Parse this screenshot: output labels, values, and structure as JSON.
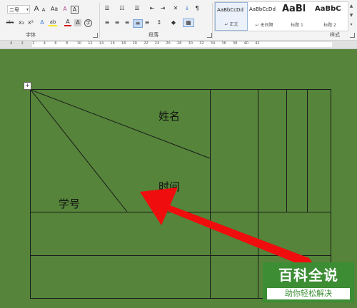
{
  "ribbon": {
    "font_group": {
      "label": "字体",
      "font_size": "二号",
      "grow_icon": "A",
      "shrink_icon": "A",
      "case_icon": "Aa",
      "clear_icon": "A",
      "char_border_icon": "A",
      "phonetic_icon": "wén",
      "strikethrough": "abc",
      "subscript": "x₂",
      "superscript": "x²",
      "text_effect": "A",
      "highlight": "ab",
      "font_color": "A",
      "shading": "A",
      "encircle": "字"
    },
    "paragraph_group": {
      "label": "段落"
    },
    "styles_group": {
      "label": "样式",
      "styles": [
        {
          "sample": "AaBbCcDd",
          "name": "↵ 正文"
        },
        {
          "sample": "AaBbCcDd",
          "name": "↵ 无间隔"
        },
        {
          "sample": "AaBl",
          "name": "标题 1"
        },
        {
          "sample": "AaBbC",
          "name": "标题 2"
        }
      ]
    }
  },
  "ruler": {
    "numbers": [
      "4",
      "2",
      "2",
      "4",
      "6",
      "8",
      "10",
      "12",
      "14",
      "16",
      "18",
      "20",
      "22",
      "24",
      "26",
      "28",
      "30",
      "32",
      "34",
      "36",
      "38",
      "40",
      "42"
    ]
  },
  "table": {
    "header_name": "姓名",
    "header_time": "时间",
    "header_id": "学号"
  },
  "watermark": {
    "title": "百科全说",
    "subtitle": "助你轻松解决"
  },
  "colors": {
    "page_background": "#55843a",
    "annotation_arrow": "#f00d0d",
    "table_lines": "#1b1b1b"
  }
}
